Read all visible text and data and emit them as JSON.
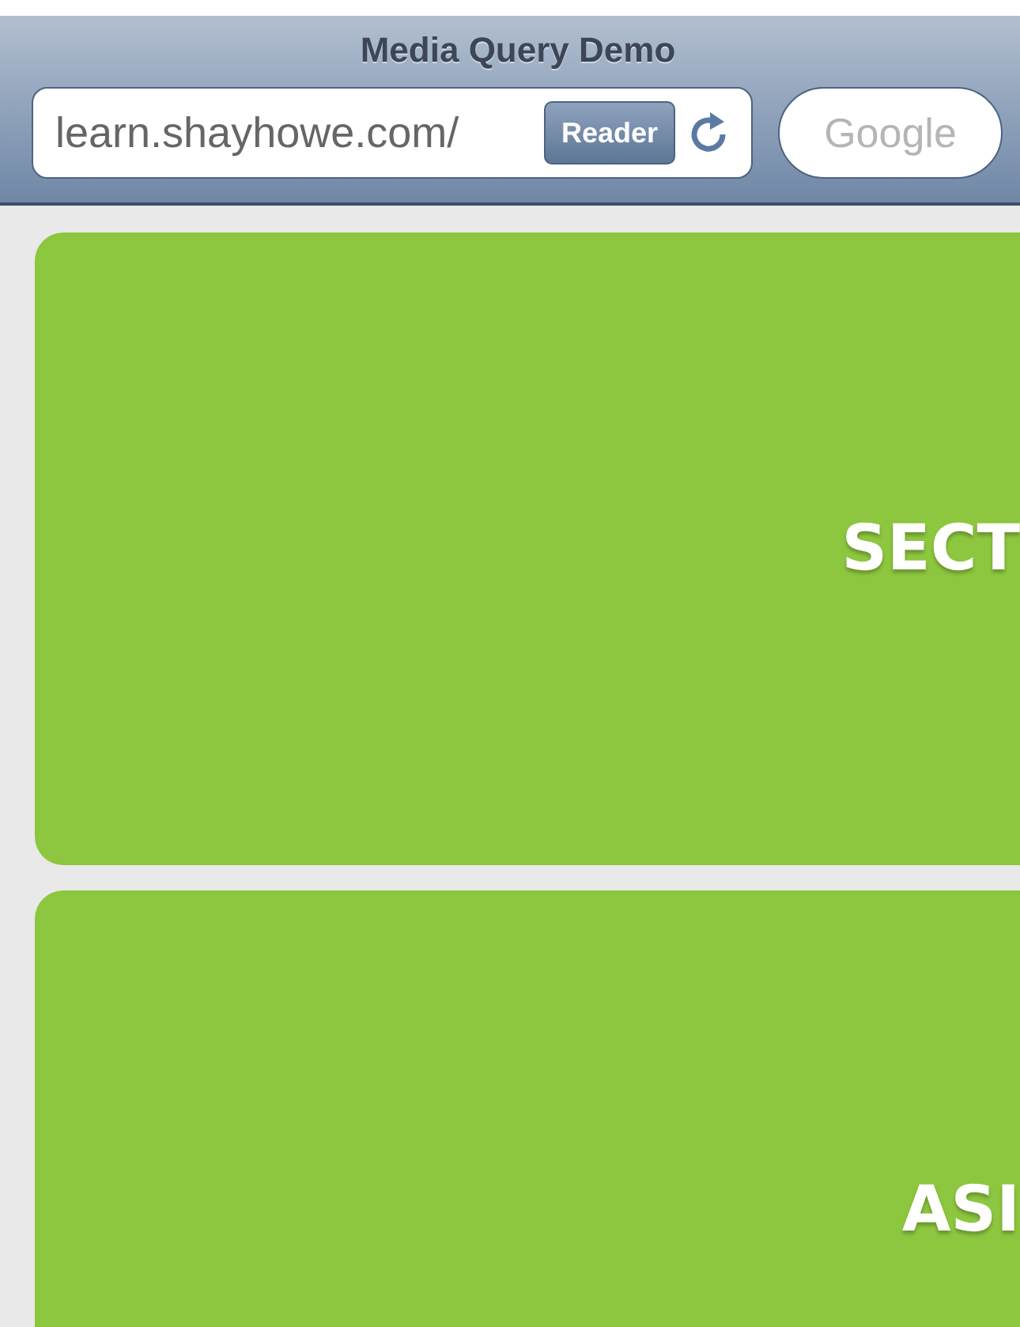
{
  "window": {
    "title": "Media Query Demo"
  },
  "address_bar": {
    "url": "learn.shayhowe.com/",
    "reader_button": "Reader"
  },
  "search": {
    "placeholder": "Google"
  },
  "sections": [
    {
      "label": "SECT"
    },
    {
      "label": "ASI"
    }
  ]
}
